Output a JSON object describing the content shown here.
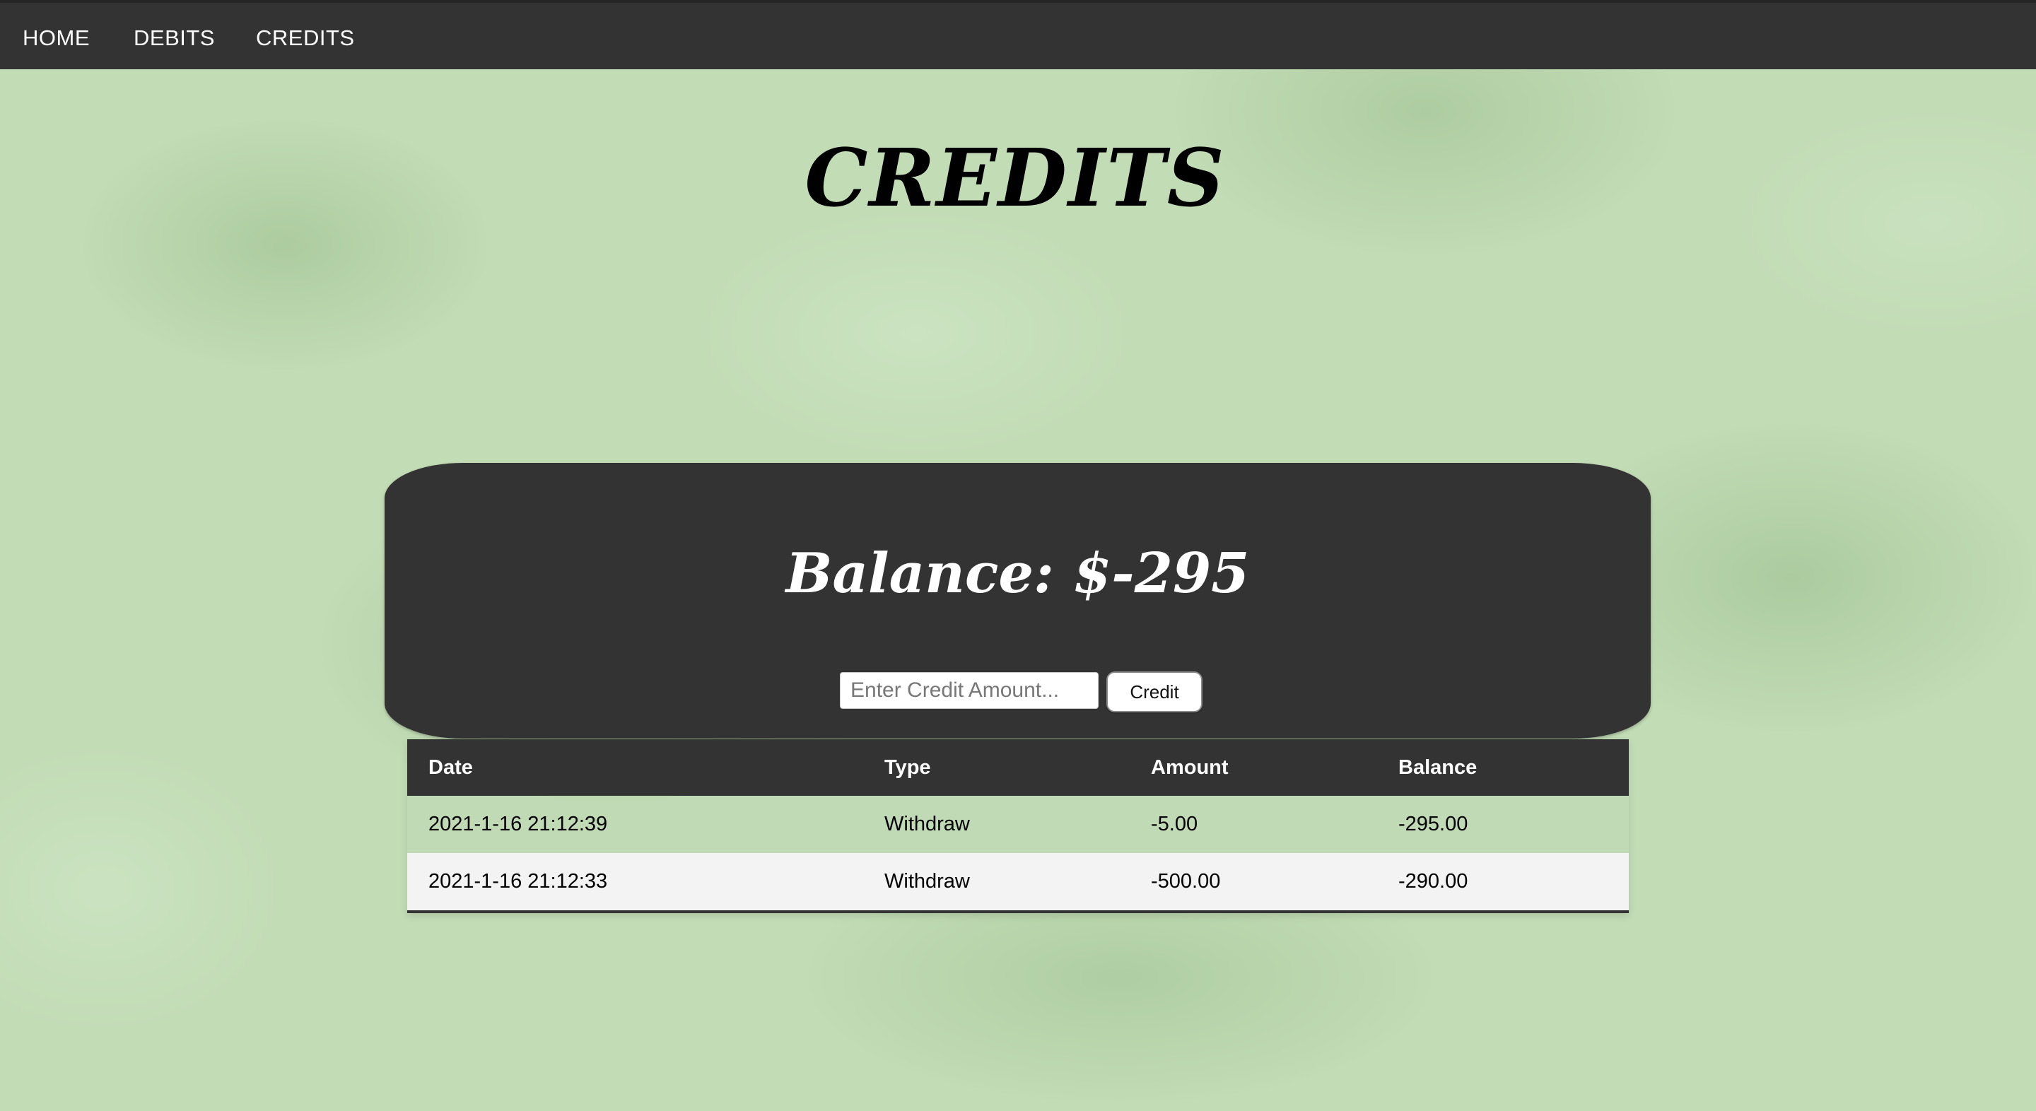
{
  "nav": {
    "items": [
      "HOME",
      "DEBITS",
      "CREDITS"
    ]
  },
  "page": {
    "title": "CREDITS"
  },
  "balance": {
    "label": "Balance: $-295"
  },
  "credit_form": {
    "input_placeholder": "Enter Credit Amount...",
    "input_value": "",
    "button_label": "Credit"
  },
  "table": {
    "headers": [
      "Date",
      "Type",
      "Amount",
      "Balance"
    ],
    "rows": [
      [
        "2021-1-16 21:12:39",
        "Withdraw",
        "-5.00",
        "-295.00"
      ],
      [
        "2021-1-16 21:12:33",
        "Withdraw",
        "-500.00",
        "-290.00"
      ]
    ]
  },
  "colors": {
    "nav_bg": "#333333",
    "card_bg": "#333333",
    "page_bg": "#c2dcb6",
    "row_alt_bg": "#f3f3f3"
  }
}
